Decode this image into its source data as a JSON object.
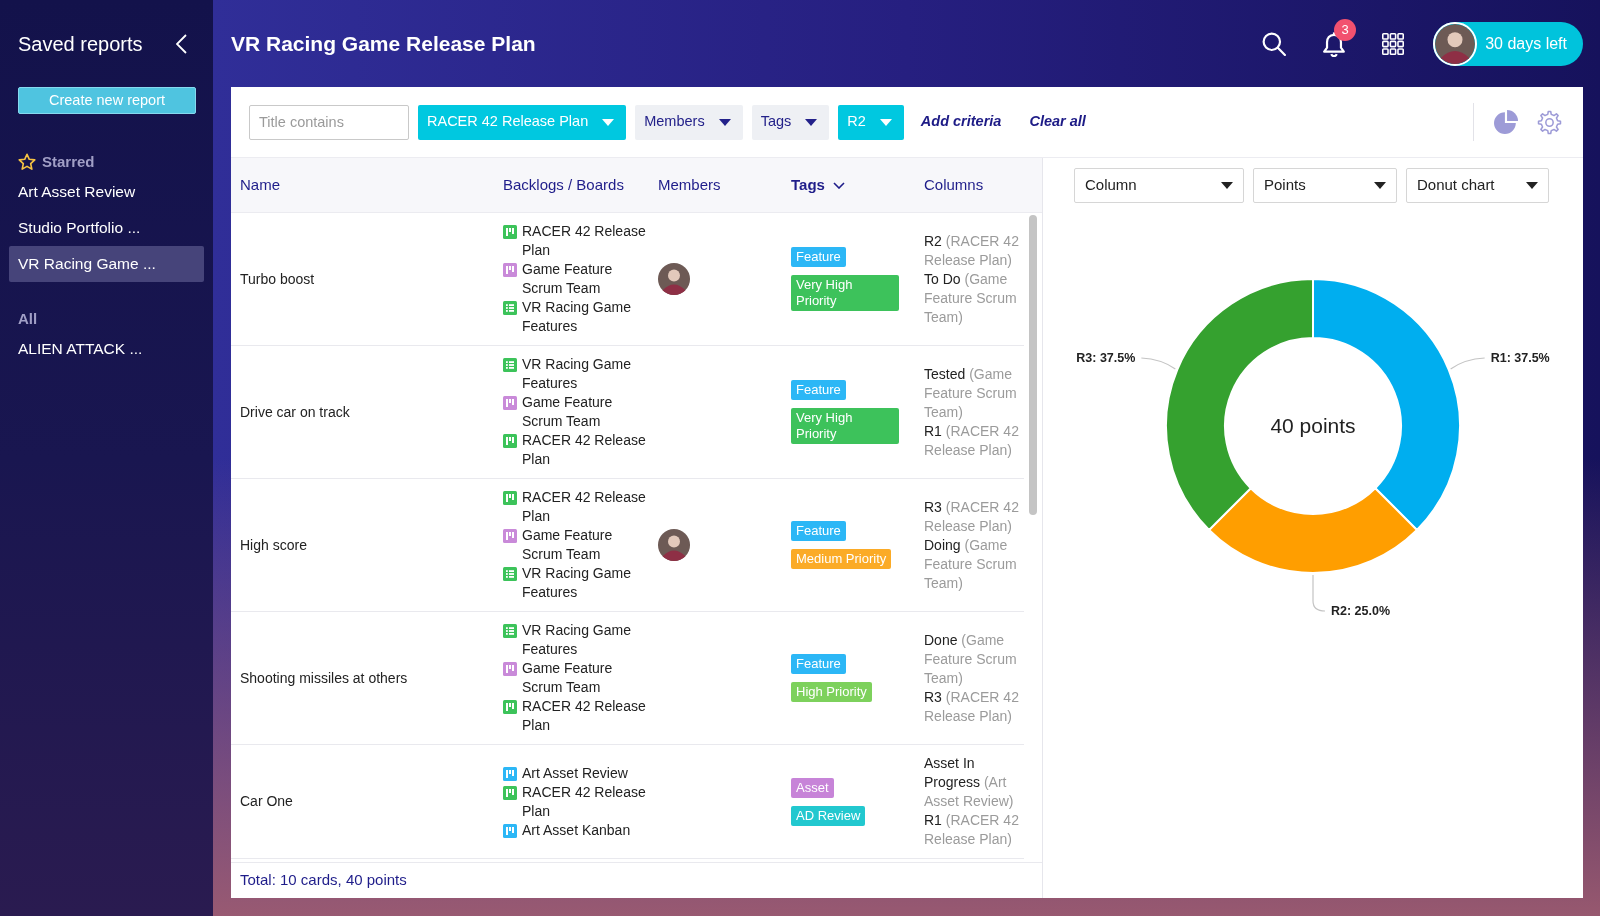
{
  "sidebar": {
    "title": "Saved reports",
    "create_button": "Create new report",
    "sections": [
      {
        "kind": "starred",
        "label": "Starred",
        "items": [
          {
            "label": "Art Asset Review",
            "selected": false
          },
          {
            "label": "Studio Portfolio ...",
            "selected": false
          },
          {
            "label": "VR Racing Game ...",
            "selected": true
          }
        ]
      },
      {
        "kind": "all",
        "label": "All",
        "items": [
          {
            "label": "ALIEN ATTACK ...",
            "selected": false
          }
        ]
      }
    ]
  },
  "header": {
    "title": "VR Racing Game Release Plan",
    "notification_count": "3",
    "trial": "30 days left"
  },
  "filters": {
    "title_field": {
      "placeholder": "Title contains"
    },
    "dropdowns": [
      {
        "label": "RACER 42 Release Plan",
        "active": true
      },
      {
        "label": "Members",
        "active": false
      },
      {
        "label": "Tags",
        "active": false
      },
      {
        "label": "R2",
        "active": true
      }
    ],
    "links": [
      "Add criteria",
      "Clear all"
    ]
  },
  "table": {
    "columns": [
      {
        "label": "Name",
        "sorted": false
      },
      {
        "label": "Backlogs / Boards",
        "sorted": false
      },
      {
        "label": "Members",
        "sorted": false
      },
      {
        "label": "Tags",
        "sorted": true
      },
      {
        "label": "Columns",
        "sorted": false
      }
    ],
    "rows": [
      {
        "name": "Turbo boost",
        "backlogs": [
          {
            "name": "RACER 42 Release Plan",
            "kind": "board",
            "color": "#3cc35a"
          },
          {
            "name": "Game Feature Scrum Team",
            "kind": "board",
            "color": "#c98ad9"
          },
          {
            "name": "VR Racing Game Features",
            "kind": "list",
            "color": "#3cc35a"
          }
        ],
        "member": true,
        "tags": [
          {
            "label": "Feature",
            "color": "#2cb7f6"
          },
          {
            "label": "Very High Priority",
            "color": "#3dc25b"
          }
        ],
        "columns": [
          {
            "name": "R2",
            "board": "(RACER 42 Release Plan)"
          },
          {
            "name": "To Do",
            "board": "(Game Feature Scrum Team)"
          }
        ]
      },
      {
        "name": "Drive car on track",
        "backlogs": [
          {
            "name": "VR Racing Game Features",
            "kind": "list",
            "color": "#3cc35a"
          },
          {
            "name": "Game Feature Scrum Team",
            "kind": "board",
            "color": "#c98ad9"
          },
          {
            "name": "RACER 42 Release Plan",
            "kind": "board",
            "color": "#3cc35a"
          }
        ],
        "member": false,
        "tags": [
          {
            "label": "Feature",
            "color": "#2cb7f6"
          },
          {
            "label": "Very High Priority",
            "color": "#3dc25b"
          }
        ],
        "columns": [
          {
            "name": "Tested",
            "board": "(Game Feature Scrum Team)"
          },
          {
            "name": "R1",
            "board": "(RACER 42 Release Plan)"
          }
        ]
      },
      {
        "name": "High score",
        "backlogs": [
          {
            "name": "RACER 42 Release Plan",
            "kind": "board",
            "color": "#3cc35a"
          },
          {
            "name": "Game Feature Scrum Team",
            "kind": "board",
            "color": "#c98ad9"
          },
          {
            "name": "VR Racing Game Features",
            "kind": "list",
            "color": "#3cc35a"
          }
        ],
        "member": true,
        "tags": [
          {
            "label": "Feature",
            "color": "#2cb7f6"
          },
          {
            "label": "Medium Priority",
            "color": "#fbab27"
          }
        ],
        "columns": [
          {
            "name": "R3",
            "board": "(RACER 42 Release Plan)"
          },
          {
            "name": "Doing",
            "board": "(Game Feature Scrum Team)"
          }
        ]
      },
      {
        "name": "Shooting missiles at others",
        "backlogs": [
          {
            "name": "VR Racing Game Features",
            "kind": "list",
            "color": "#3cc35a"
          },
          {
            "name": "Game Feature Scrum Team",
            "kind": "board",
            "color": "#c98ad9"
          },
          {
            "name": "RACER 42 Release Plan",
            "kind": "board",
            "color": "#3cc35a"
          }
        ],
        "member": false,
        "tags": [
          {
            "label": "Feature",
            "color": "#2cb7f6"
          },
          {
            "label": "High Priority",
            "color": "#7dd15c"
          }
        ],
        "columns": [
          {
            "name": "Done",
            "board": "(Game Feature Scrum Team)"
          },
          {
            "name": "R3",
            "board": "(RACER 42 Release Plan)"
          }
        ]
      },
      {
        "name": "Car One",
        "backlogs": [
          {
            "name": "Art Asset Review",
            "kind": "board",
            "color": "#2cb7f6"
          },
          {
            "name": "RACER 42 Release Plan",
            "kind": "board",
            "color": "#3cc35a"
          },
          {
            "name": "Art Asset Kanban",
            "kind": "board",
            "color": "#2cb7f6"
          }
        ],
        "member": false,
        "tags": [
          {
            "label": "Asset",
            "color": "#c784d8"
          },
          {
            "label": "AD Review",
            "color": "#22c8cf"
          }
        ],
        "columns": [
          {
            "name": "Asset In Progress",
            "board": "(Art Asset Review)"
          },
          {
            "name": "R1",
            "board": "(RACER 42 Release Plan)"
          }
        ]
      }
    ],
    "footer": "Total: 10 cards, 40 points"
  },
  "chart": {
    "selects": [
      "Column",
      "Points",
      "Donut chart"
    ],
    "center_label": "40 points",
    "chart_data": {
      "type": "donut",
      "values": [
        37.5,
        25,
        37.5
      ],
      "colors": [
        "#00aeef",
        "#ff9e00",
        "#35a12f"
      ],
      "value_labels": [
        "R1: 37.5%",
        "R2: 25.0%",
        "R3: 37.5%"
      ]
    }
  }
}
